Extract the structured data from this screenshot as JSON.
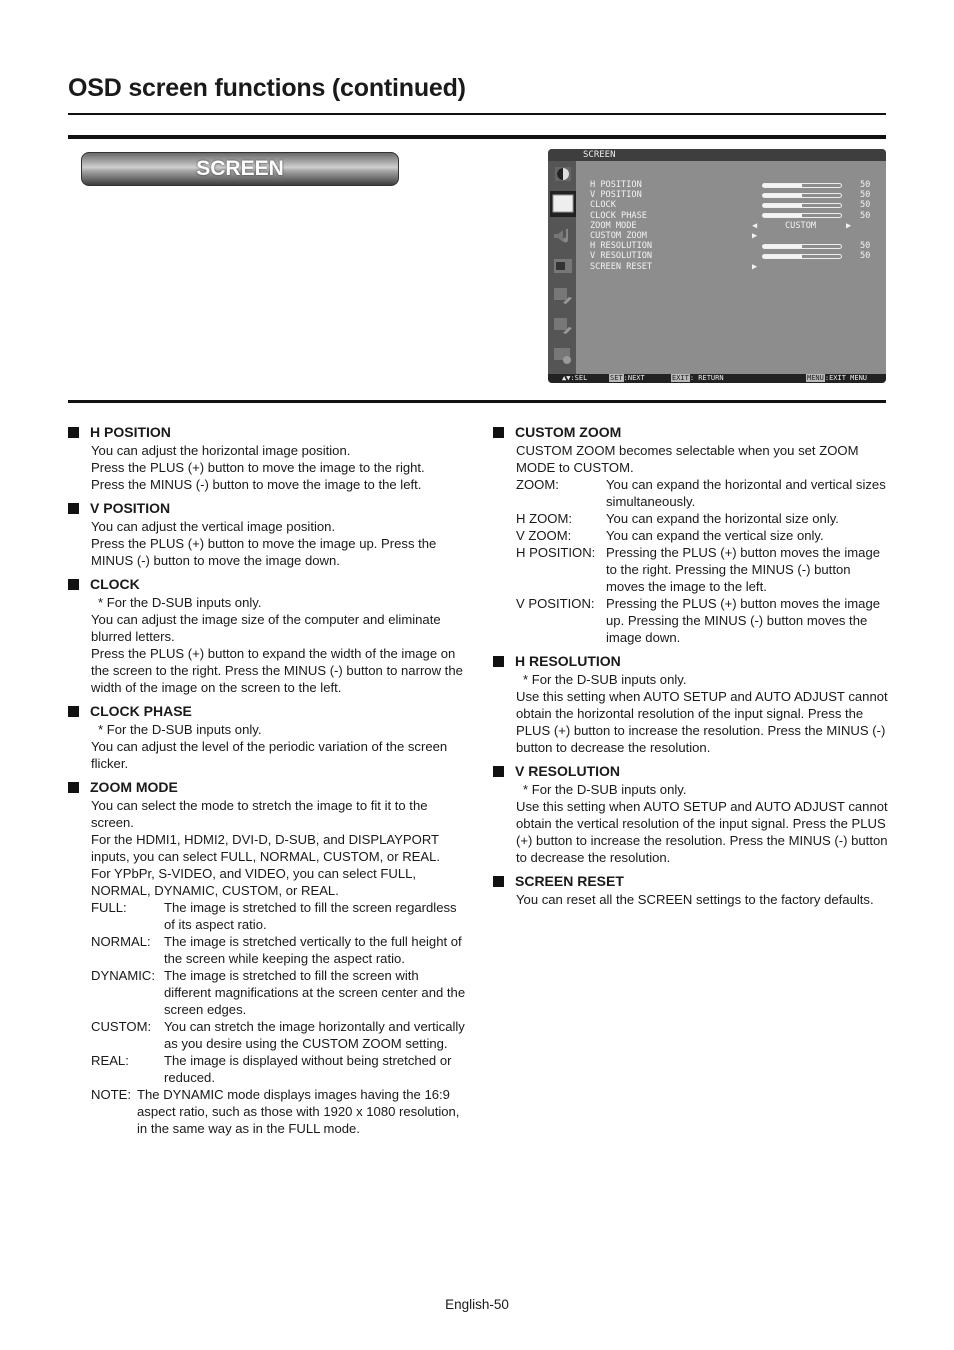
{
  "page": {
    "title": "OSD screen functions (continued)",
    "section_badge": "SCREEN",
    "footer": "English-50"
  },
  "osd": {
    "title": "SCREEN",
    "side_icons": [
      "picture-icon",
      "screen-icon",
      "audio-icon",
      "pip-icon",
      "advanced-setup-1-icon",
      "advanced-setup-2-icon",
      "multi-display-icon"
    ],
    "selected_icon": "screen-icon",
    "rows": [
      {
        "label": "H POSITION",
        "type": "slider",
        "value": 50,
        "fill": 0.5
      },
      {
        "label": "V POSITION",
        "type": "slider",
        "value": 50,
        "fill": 0.5
      },
      {
        "label": "CLOCK",
        "type": "slider",
        "value": 50,
        "fill": 0.5
      },
      {
        "label": "CLOCK PHASE",
        "type": "slider",
        "value": 50,
        "fill": 0.5
      },
      {
        "label": "ZOOM MODE",
        "type": "select",
        "value": "CUSTOM",
        "left": "◀",
        "right": "▶"
      },
      {
        "label": "CUSTOM ZOOM",
        "type": "submenu",
        "arrow": "▶"
      },
      {
        "label": "H RESOLUTION",
        "type": "slider",
        "value": 50,
        "fill": 0.5
      },
      {
        "label": "V RESOLUTION",
        "type": "slider",
        "value": 50,
        "fill": 0.5
      },
      {
        "label": "SCREEN RESET",
        "type": "submenu",
        "arrow": "▶"
      }
    ],
    "footer": {
      "sel": "▲▼:SEL",
      "set_key": "SET",
      "set_label": ":NEXT",
      "exit_key": "EXIT",
      "exit_label": ": RETURN",
      "menu_key": "MENU",
      "menu_label": ":EXIT MENU"
    }
  },
  "left_column": [
    {
      "heading": "H POSITION",
      "paras": [
        "You can adjust the horizontal image position.",
        "Press the PLUS (+) button to move the image to the right.",
        "Press the MINUS (-) button to move the image to the left."
      ]
    },
    {
      "heading": "V POSITION",
      "paras": [
        "You can adjust the vertical image position.",
        "Press the PLUS (+) button to move the image up. Press the MINUS (-) button to move the image down."
      ]
    },
    {
      "heading": "CLOCK",
      "note": "* For the D-SUB inputs only.",
      "paras": [
        "You can adjust the image size of the computer and eliminate blurred letters.",
        "Press the PLUS (+) button to expand the width of the image on the screen to the right. Press the MINUS (-) button to narrow the width of the image on the screen to the left."
      ]
    },
    {
      "heading": "CLOCK PHASE",
      "note": "* For the D-SUB inputs only.",
      "paras": [
        "You can adjust the level of the periodic variation of the screen flicker."
      ]
    },
    {
      "heading": "ZOOM MODE",
      "paras": [
        "You can select the mode to stretch the image to fit it to the screen.",
        "For the HDMI1, HDMI2, DVI-D, D-SUB, and DISPLAYPORT inputs, you can select FULL, NORMAL, CUSTOM, or REAL.",
        "For YPbPr, S-VIDEO, and VIDEO, you can select FULL, NORMAL, DYNAMIC, CUSTOM, or REAL."
      ],
      "defs": [
        {
          "k": "FULL:",
          "v": "The image is stretched to fill the screen regardless of its aspect ratio."
        },
        {
          "k": "NORMAL:",
          "v": "The image is stretched vertically to the full height of the screen while keeping the aspect ratio."
        },
        {
          "k": "DYNAMIC:",
          "v": "The image is stretched to fill the screen with different magnifications at the screen center and the screen edges."
        },
        {
          "k": "CUSTOM:",
          "v": "You can stretch the image horizontally and vertically as you desire using the CUSTOM ZOOM setting."
        },
        {
          "k": "REAL:",
          "v": "The image is displayed without being stretched or reduced."
        }
      ],
      "note_def": {
        "k": "NOTE:",
        "v": "The DYNAMIC mode displays images having the 16:9 aspect ratio, such as those with 1920 x 1080 resolution, in the same way as in the FULL mode."
      }
    }
  ],
  "right_column": [
    {
      "heading": "CUSTOM ZOOM",
      "paras": [
        "CUSTOM ZOOM becomes selectable when you set ZOOM MODE to CUSTOM."
      ],
      "defs": [
        {
          "k": "ZOOM:",
          "v": "You can expand the horizontal and vertical sizes simultaneously."
        },
        {
          "k": "H ZOOM:",
          "v": "You can expand the horizontal size only."
        },
        {
          "k": "V ZOOM:",
          "v": "You can expand the vertical size only."
        },
        {
          "k": "H POSITION:",
          "v": "Pressing the PLUS (+) button moves the image to the right. Pressing the MINUS (-) button moves the image to the left."
        },
        {
          "k": "V POSITION:",
          "v": "Pressing the PLUS (+) button moves the image up. Pressing the MINUS (-) button moves the image down."
        }
      ]
    },
    {
      "heading": "H RESOLUTION",
      "note": "* For the D-SUB inputs only.",
      "paras": [
        "Use this setting when AUTO SETUP and AUTO ADJUST cannot obtain the horizontal resolution of the input signal. Press the PLUS (+) button to increase the resolution. Press the MINUS (-) button to decrease the resolution."
      ]
    },
    {
      "heading": "V RESOLUTION",
      "note": "* For the D-SUB inputs only.",
      "paras": [
        "Use this setting when AUTO SETUP and AUTO ADJUST cannot obtain the vertical resolution of the input signal. Press the PLUS (+) button to increase the resolution. Press the MINUS (-) button to decrease the resolution."
      ]
    },
    {
      "heading": "SCREEN RESET",
      "paras": [
        "You can reset all the SCREEN settings to the factory defaults."
      ]
    }
  ]
}
